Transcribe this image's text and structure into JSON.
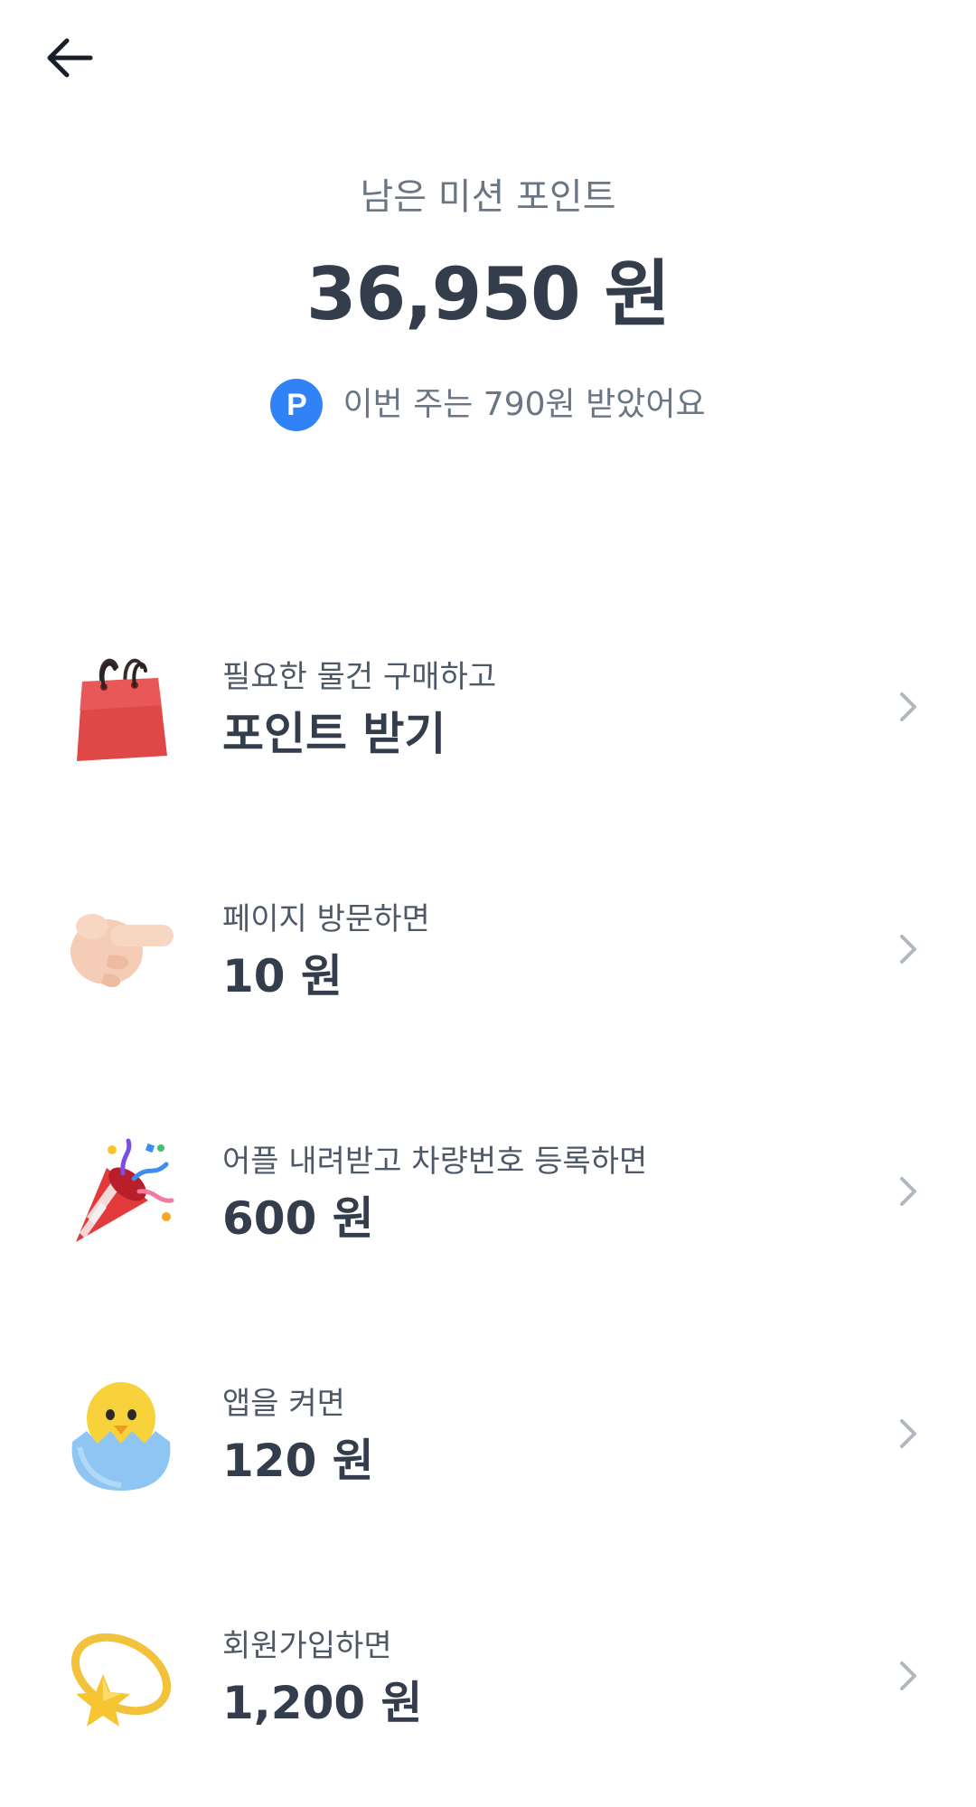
{
  "header": {
    "back_icon": "arrow-left-icon",
    "label": "남은 미션 포인트",
    "amount": "36,950 원",
    "weekly_badge": "P",
    "weekly_text": "이번 주는 790원 받았어요"
  },
  "colors": {
    "accent": "#3182f6",
    "text_primary": "#333d4b",
    "text_secondary": "#6b7684",
    "chevron": "#b0b8c1"
  },
  "missions": [
    {
      "icon": "shopping-bag-icon",
      "subtitle": "필요한 물건 구매하고",
      "title": "포인트 받기"
    },
    {
      "icon": "pointing-hand-icon",
      "subtitle": "페이지 방문하면",
      "title": "10 원"
    },
    {
      "icon": "party-popper-icon",
      "subtitle": "어플 내려받고 차량번호 등록하면",
      "title": "600 원"
    },
    {
      "icon": "hatching-chick-icon",
      "subtitle": "앱을 켜면",
      "title": "120 원"
    },
    {
      "icon": "dizzy-star-icon",
      "subtitle": "회원가입하면",
      "title": "1,200 원"
    }
  ]
}
